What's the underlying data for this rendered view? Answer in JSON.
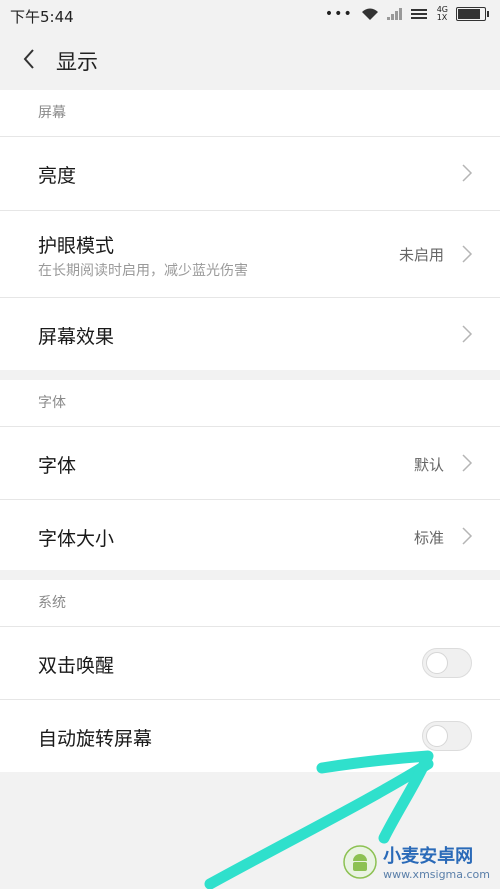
{
  "status_bar": {
    "time": "下午5:44",
    "dots": "•••",
    "net_top": "4G",
    "net_bottom": "1X",
    "battery_level": 0.85
  },
  "header": {
    "title": "显示"
  },
  "sections": {
    "screen": {
      "title": "屏幕",
      "brightness": {
        "label": "亮度"
      },
      "eye_care": {
        "label": "护眼模式",
        "sub": "在长期阅读时启用，减少蓝光伤害",
        "value": "未启用"
      },
      "screen_effect": {
        "label": "屏幕效果"
      }
    },
    "font": {
      "title": "字体",
      "font": {
        "label": "字体",
        "value": "默认"
      },
      "font_size": {
        "label": "字体大小",
        "value": "标准"
      }
    },
    "system": {
      "title": "系统",
      "double_tap": {
        "label": "双击唤醒",
        "on": false
      },
      "auto_rotate": {
        "label": "自动旋转屏幕",
        "on": false
      }
    }
  },
  "watermark": {
    "name": "小麦安卓网",
    "url": "www.xmsigma.com"
  },
  "colors": {
    "annotation_arrow": "#2fe0cc",
    "watermark": "#2a6ab8"
  }
}
